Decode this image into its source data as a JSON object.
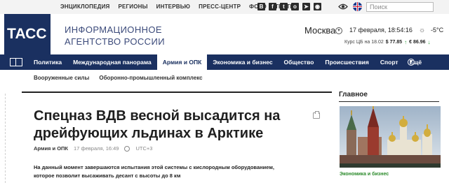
{
  "topbar": {
    "links": [
      "ЭНЦИКЛОПЕДИЯ",
      "РЕГИОНЫ",
      "ИНТЕРВЬЮ",
      "ПРЕСС-ЦЕНТР",
      "ФОТО",
      "ТЕСТЫ"
    ],
    "social_icons": [
      "vk-icon",
      "facebook-icon",
      "twitter-icon",
      "ok-icon",
      "telegram-icon",
      "rss-icon"
    ],
    "search_placeholder": "Поиск"
  },
  "header": {
    "logo_text": "ТАСС",
    "agency_line1": "ИНФОРМАЦИОННОЕ",
    "agency_line2": "АГЕНТСТВО РОССИИ",
    "city": "Москва",
    "datetime": "17 февраля, 18:54:16",
    "temperature": "-5°C",
    "rates_label": "Курс ЦБ на 18.02",
    "usd": "$ 77.85",
    "eur": "€ 86.96"
  },
  "nav": {
    "items": [
      {
        "label": "Политика",
        "active": false
      },
      {
        "label": "Международная панорама",
        "active": false
      },
      {
        "label": "Армия и ОПК",
        "active": true
      },
      {
        "label": "Экономика и бизнес",
        "active": false
      },
      {
        "label": "Общество",
        "active": false
      },
      {
        "label": "Происшествия",
        "active": false
      },
      {
        "label": "Спорт",
        "active": false
      },
      {
        "label": "Ещё",
        "active": false
      }
    ]
  },
  "subnav": {
    "items": [
      "Вооруженные силы",
      "Оборонно-промышленный комплекс"
    ]
  },
  "article": {
    "headline": "Спецназ ВДВ весной высадится на дрейфующих льдинах в Арктике",
    "category": "Армия и ОПК",
    "date": "17 февраля, 16:49",
    "timezone": "UTC+3",
    "lead": "На данный момент завершаются испытания этой системы с кислородным оборудованием, которое позволит высаживать десант с высоты до 8 км"
  },
  "sidebar": {
    "title": "Главное",
    "item_category": "Экономика и бизнес"
  },
  "colors": {
    "brand_navy": "#1a3060",
    "accent_green": "#2a8a2a"
  }
}
